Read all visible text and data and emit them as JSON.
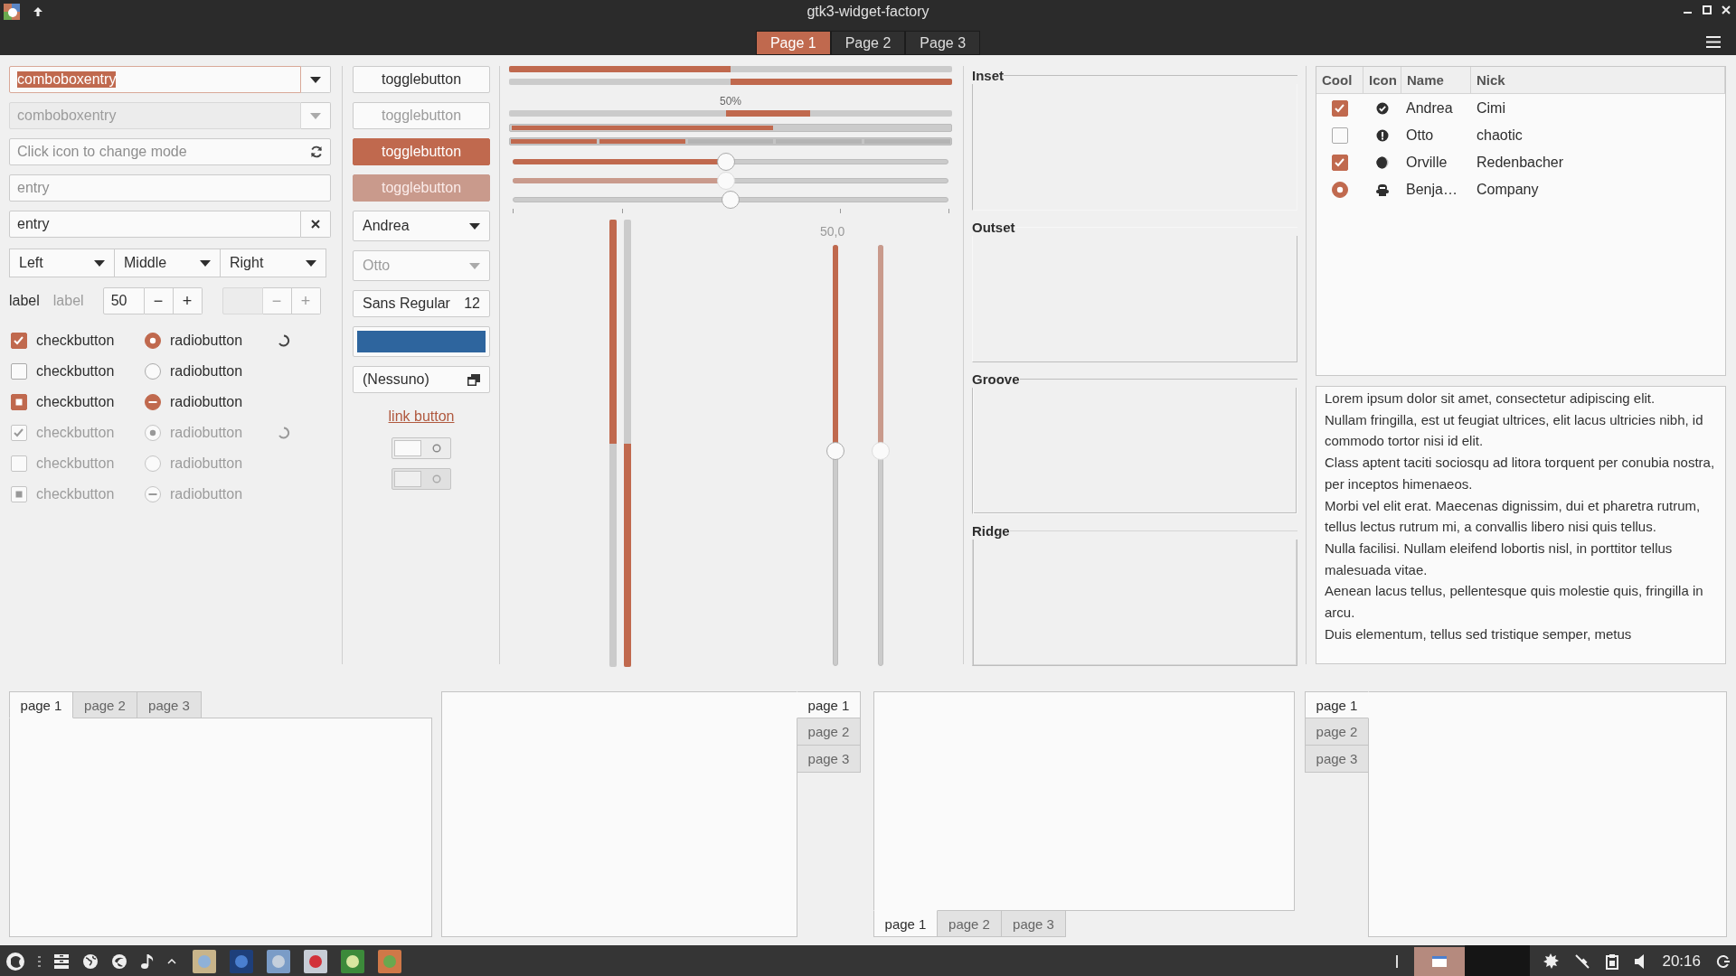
{
  "window": {
    "title": "gtk3-widget-factory",
    "pages": [
      {
        "label": "Page 1",
        "selected": true
      },
      {
        "label": "Page 2",
        "selected": false
      },
      {
        "label": "Page 3",
        "selected": false
      }
    ]
  },
  "entries": [
    {
      "kind": "combo",
      "value": "comboboxentry",
      "text_selected": true,
      "focused": true,
      "disabled": false
    },
    {
      "kind": "combo",
      "value": "comboboxentry",
      "text_selected": false,
      "focused": false,
      "disabled": true
    },
    {
      "kind": "icon",
      "placeholder": "Click icon to change mode",
      "focused": false,
      "disabled": false
    },
    {
      "kind": "plain",
      "placeholder": "entry",
      "focused": false,
      "disabled": false
    },
    {
      "kind": "clear",
      "value": "entry",
      "text_selected": false,
      "focused": false,
      "disabled": false
    }
  ],
  "linked_combos": [
    {
      "value": "Left"
    },
    {
      "value": "Middle"
    },
    {
      "value": "Right"
    }
  ],
  "labels": [
    {
      "text": "label",
      "disabled": false
    },
    {
      "text": "label",
      "disabled": true
    }
  ],
  "spinbuttons": [
    {
      "value": "50",
      "minus": "−",
      "plus": "+",
      "disabled": false
    },
    {
      "minus": "−",
      "plus": "+",
      "disabled": true
    }
  ],
  "toggle_rows": [
    {
      "check": {
        "label": "checkbutton",
        "checked": true,
        "inconsistent": false,
        "disabled": false
      },
      "radio": {
        "label": "radiobutton",
        "checked": true,
        "inconsistent": false,
        "disabled": false
      },
      "spinner": true
    },
    {
      "check": {
        "label": "checkbutton",
        "checked": false,
        "inconsistent": false,
        "disabled": false
      },
      "radio": {
        "label": "radiobutton",
        "checked": false,
        "inconsistent": false,
        "disabled": false
      },
      "spinner": false
    },
    {
      "check": {
        "label": "checkbutton",
        "inconsistent": true,
        "disabled": false
      },
      "radio": {
        "label": "radiobutton",
        "inconsistent": true,
        "disabled": false
      },
      "spinner": false
    },
    {
      "check": {
        "label": "checkbutton",
        "checked": true,
        "inconsistent": false,
        "disabled": true
      },
      "radio": {
        "label": "radiobutton",
        "checked": true,
        "inconsistent": false,
        "disabled": true
      },
      "spinner": true
    },
    {
      "check": {
        "label": "checkbutton",
        "checked": false,
        "inconsistent": false,
        "disabled": true
      },
      "radio": {
        "label": "radiobutton",
        "checked": false,
        "inconsistent": false,
        "disabled": true
      },
      "spinner": false
    },
    {
      "check": {
        "label": "checkbutton",
        "inconsistent": true,
        "disabled": true
      },
      "radio": {
        "label": "radiobutton",
        "inconsistent": true,
        "disabled": true
      },
      "spinner": false
    }
  ],
  "togglebuttons": [
    {
      "label": "togglebutton",
      "active": false,
      "disabled": false
    },
    {
      "label": "togglebutton",
      "active": false,
      "disabled": true
    },
    {
      "label": "togglebutton",
      "active": true,
      "disabled": false
    },
    {
      "label": "togglebutton",
      "active": true,
      "disabled": true
    }
  ],
  "combo_boxes": [
    {
      "value": "Andrea",
      "disabled": false
    },
    {
      "value": "Otto",
      "disabled": true
    }
  ],
  "font_button": {
    "family": "Sans Regular",
    "size": "12"
  },
  "color_button": {
    "color": "#2e659e"
  },
  "file_chooser": {
    "value": "(Nessuno)"
  },
  "link_button": {
    "label": "link button"
  },
  "switches": [
    {
      "on": false,
      "disabled": false
    },
    {
      "on": false,
      "disabled": true
    }
  ],
  "ranges": [
    {
      "kind": "progress",
      "level": 0.5,
      "inverted": false
    },
    {
      "kind": "progress",
      "level": 0.5,
      "inverted": true
    },
    {
      "kind": "pulse",
      "text": "50%"
    },
    {
      "kind": "levelbar",
      "level": 0.6
    },
    {
      "kind": "discrete",
      "level": 0.4
    },
    {
      "kind": "scale",
      "level": 0.49,
      "disabled": false,
      "highlight": true,
      "marks": false
    },
    {
      "kind": "scale",
      "level": 0.49,
      "disabled": true,
      "highlight": true,
      "marks": false
    },
    {
      "kind": "scale",
      "level": 0.5,
      "disabled": false,
      "highlight": false,
      "marks": true
    }
  ],
  "vertical": {
    "progress": [
      {
        "level": 0.5,
        "inverted": true
      },
      {
        "level": 0.5,
        "inverted": false
      }
    ],
    "scale_value": "50,0",
    "scales": [
      {
        "level": 0.49,
        "disabled": false
      },
      {
        "level": 0.49,
        "disabled": true
      }
    ]
  },
  "frames": [
    {
      "label": "Inset",
      "kind": "inset"
    },
    {
      "label": "Outset",
      "kind": "outset"
    },
    {
      "label": "Groove",
      "kind": "groove"
    },
    {
      "label": "Ridge",
      "kind": "ridge"
    }
  ],
  "tree": {
    "columns": [
      "Cool",
      "Icon",
      "Name",
      "Nick"
    ],
    "rows": [
      {
        "kind": "check",
        "active": true,
        "name": "Andrea",
        "nick": "Cimi"
      },
      {
        "kind": "check",
        "active": false,
        "name": "Otto",
        "nick": "chaotic"
      },
      {
        "kind": "check",
        "active": true,
        "name": "Orville",
        "nick": "Redenbacher"
      },
      {
        "kind": "radio",
        "active": true,
        "name": "Benja…",
        "nick": "Company"
      }
    ]
  },
  "text_view": [
    "Lorem ipsum dolor sit amet, consectetur adipiscing elit.",
    "Nullam fringilla, est ut feugiat ultrices, elit lacus ultricies nibh, id commodo tortor nisi id elit.",
    "Class aptent taciti sociosqu ad litora torquent per conubia nostra, per inceptos himenaeos.",
    "Morbi vel elit erat. Maecenas dignissim, dui et pharetra rutrum, tellus lectus rutrum mi, a convallis libero nisi quis tellus.",
    "Nulla facilisi. Nullam eleifend lobortis nisl, in porttitor tellus malesuada vitae.",
    "Aenean lacus tellus, pellentesque quis molestie quis, fringilla in arcu.",
    "Duis elementum, tellus sed tristique semper, metus"
  ],
  "notebooks": [
    {
      "kind": "top",
      "tabs": [
        {
          "label": "page 1",
          "selected": true
        },
        {
          "label": "page 2",
          "selected": false
        },
        {
          "label": "page 3",
          "selected": false
        }
      ]
    },
    {
      "kind": "right",
      "tabs": [
        {
          "label": "page 1",
          "selected": true
        },
        {
          "label": "page 2",
          "selected": false
        },
        {
          "label": "page 3",
          "selected": false
        }
      ]
    },
    {
      "kind": "bottom",
      "tabs": [
        {
          "label": "page 1",
          "selected": true
        },
        {
          "label": "page 2",
          "selected": false
        },
        {
          "label": "page 3",
          "selected": false
        }
      ]
    },
    {
      "kind": "left",
      "tabs": [
        {
          "label": "page 1",
          "selected": true
        },
        {
          "label": "page 2",
          "selected": false
        },
        {
          "label": "page 3",
          "selected": false
        }
      ]
    }
  ],
  "taskbar": {
    "clock": "20:16"
  }
}
